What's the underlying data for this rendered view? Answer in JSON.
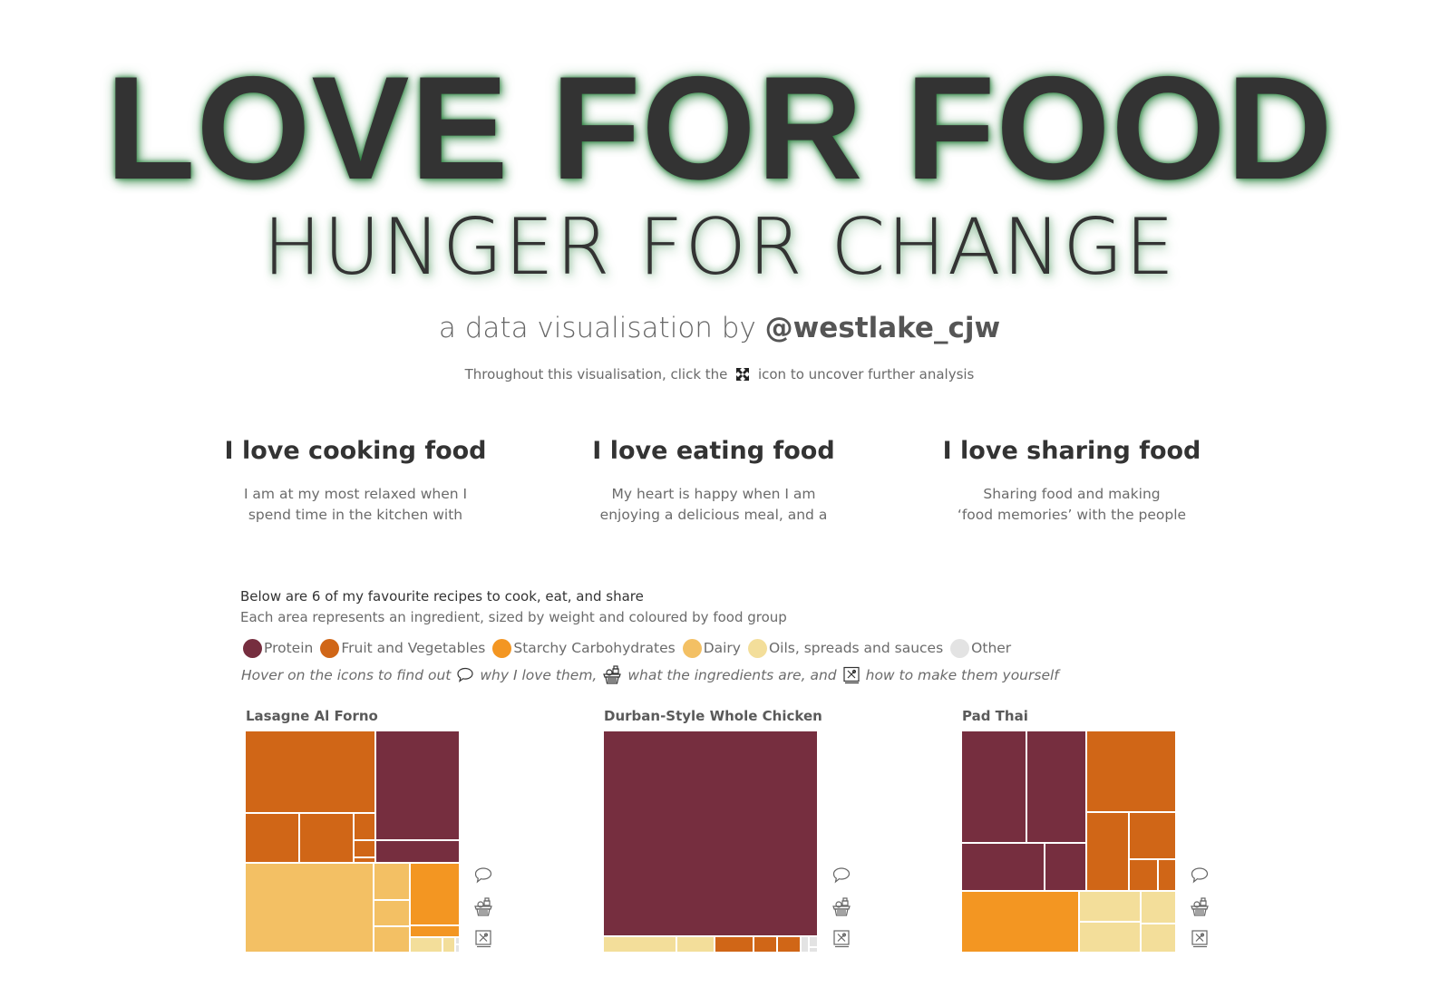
{
  "header": {
    "title": "LOVE FOR FOOD",
    "subtitle": "HUNGER FOR CHANGE",
    "byline_prefix": "a data visualisation by ",
    "byline_handle": "@westlake_cjw",
    "hint_before": "Throughout this visualisation, click the",
    "hint_icon": "expand-icon",
    "hint_after": "icon to uncover further analysis"
  },
  "columns": [
    {
      "heading": "I love cooking food",
      "line1": "I am at my most relaxed when I",
      "line2": "spend time in the kitchen with",
      "more": ".."
    },
    {
      "heading": "I love eating food",
      "line1": "My heart is happy when I am",
      "line2": "enjoying a delicious meal, and a",
      "more": ".."
    },
    {
      "heading": "I love sharing food",
      "line1": "Sharing food and making",
      "line2": "‘food memories’ with the people",
      "more": ".."
    }
  ],
  "intro": {
    "line1": "Below are 6 of my favourite recipes to cook, eat, and share",
    "line2": "Each area represents an ingredient, sized by weight and coloured by food group"
  },
  "legend": [
    {
      "label": "Protein",
      "color": "#762e3f"
    },
    {
      "label": "Fruit and Vegetables",
      "color": "#d06617"
    },
    {
      "label": "Starchy Carbohydrates",
      "color": "#f39622"
    },
    {
      "label": "Dairy",
      "color": "#f3c064"
    },
    {
      "label": "Oils, spreads and sauces",
      "color": "#f3de9a"
    },
    {
      "label": "Other",
      "color": "#e3e3e3"
    }
  ],
  "hover_line": {
    "part1": "Hover on the icons to find out",
    "icon1": "speech-bubble-icon",
    "part2": "why I love them,",
    "icon2": "basket-icon",
    "part3": "what the ingredients are, and",
    "icon3": "recipe-book-icon",
    "part4": "how to make them yourself"
  },
  "recipes": [
    {
      "name": "Lasagne Al Forno"
    },
    {
      "name": "Durban-Style Whole Chicken"
    },
    {
      "name": "Pad Thai"
    }
  ],
  "chart_data": [
    {
      "type": "treemap",
      "title": "Lasagne Al Forno",
      "measure": "ingredient weight (relative share, estimated)",
      "groups": [
        {
          "group": "Fruit and Vegetables",
          "values": [
            28,
            7,
            7,
            1.5,
            1,
            0.3
          ]
        },
        {
          "group": "Protein",
          "values": [
            24,
            5
          ]
        },
        {
          "group": "Dairy",
          "values": [
            30,
            3.5,
            2.5,
            2.5
          ]
        },
        {
          "group": "Starchy Carbohydrates",
          "values": [
            8,
            1.5
          ]
        },
        {
          "group": "Oils, spreads and sauces",
          "values": [
            1.3,
            0.5
          ]
        },
        {
          "group": "Other",
          "values": [
            0.1,
            0.1
          ]
        }
      ]
    },
    {
      "type": "treemap",
      "title": "Durban-Style Whole Chicken",
      "measure": "ingredient weight (relative share, estimated)",
      "groups": [
        {
          "group": "Protein",
          "values": [
            92
          ]
        },
        {
          "group": "Oils, spreads and sauces",
          "values": [
            2.5,
            1.3
          ]
        },
        {
          "group": "Fruit and Vegetables",
          "values": [
            1.3,
            0.8,
            0.8
          ]
        },
        {
          "group": "Other",
          "values": [
            0.3,
            0.2,
            0.1
          ]
        }
      ]
    },
    {
      "type": "treemap",
      "title": "Pad Thai",
      "measure": "ingredient weight (relative share, estimated)",
      "groups": [
        {
          "group": "Protein",
          "values": [
            13,
            12,
            7,
            3.5
          ]
        },
        {
          "group": "Fruit and Vegetables",
          "values": [
            13,
            6,
            4,
            1.6,
            1
          ]
        },
        {
          "group": "Starchy Carbohydrates",
          "values": [
            13
          ]
        },
        {
          "group": "Oils, spreads and sauces",
          "values": [
            3.4,
            3.4,
            2.1,
            1.8
          ]
        }
      ]
    }
  ]
}
